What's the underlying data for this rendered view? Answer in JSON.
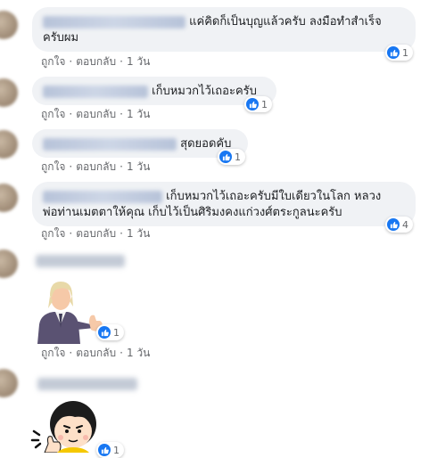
{
  "actions": {
    "like": "ถูกใจ",
    "reply": "ตอบกลับ",
    "time": "1 วัน",
    "sep": "·"
  },
  "comments": [
    {
      "text": "แค่คิดก็เป็นบุญแล้วครับ ลงมือทำสำเร็จ",
      "text2": "ครับผม",
      "reactions": "1"
    },
    {
      "text": "เก็บหมวกไว้เถอะครับ",
      "reactions": "1"
    },
    {
      "text": "สุดยอดคับ",
      "reactions": "1"
    },
    {
      "text": "เก็บหมวกไว้เถอะครับมีใบเดียวในโลก หลวง",
      "text2": "พ่อท่านเมตตาให้คุณ เก็บไว้เป็นศิริมงคงแก่วงศ์ตระกูลนะครับ",
      "reactions": "4"
    },
    {
      "sticker": "thumbs-up-man-sticker",
      "reactions": "1"
    },
    {
      "sticker": "thumbs-up-girl-sticker",
      "reactions": "1"
    }
  ],
  "colors": {
    "accent": "#1877f2",
    "bubble": "#f0f2f5",
    "meta": "#65676b"
  }
}
